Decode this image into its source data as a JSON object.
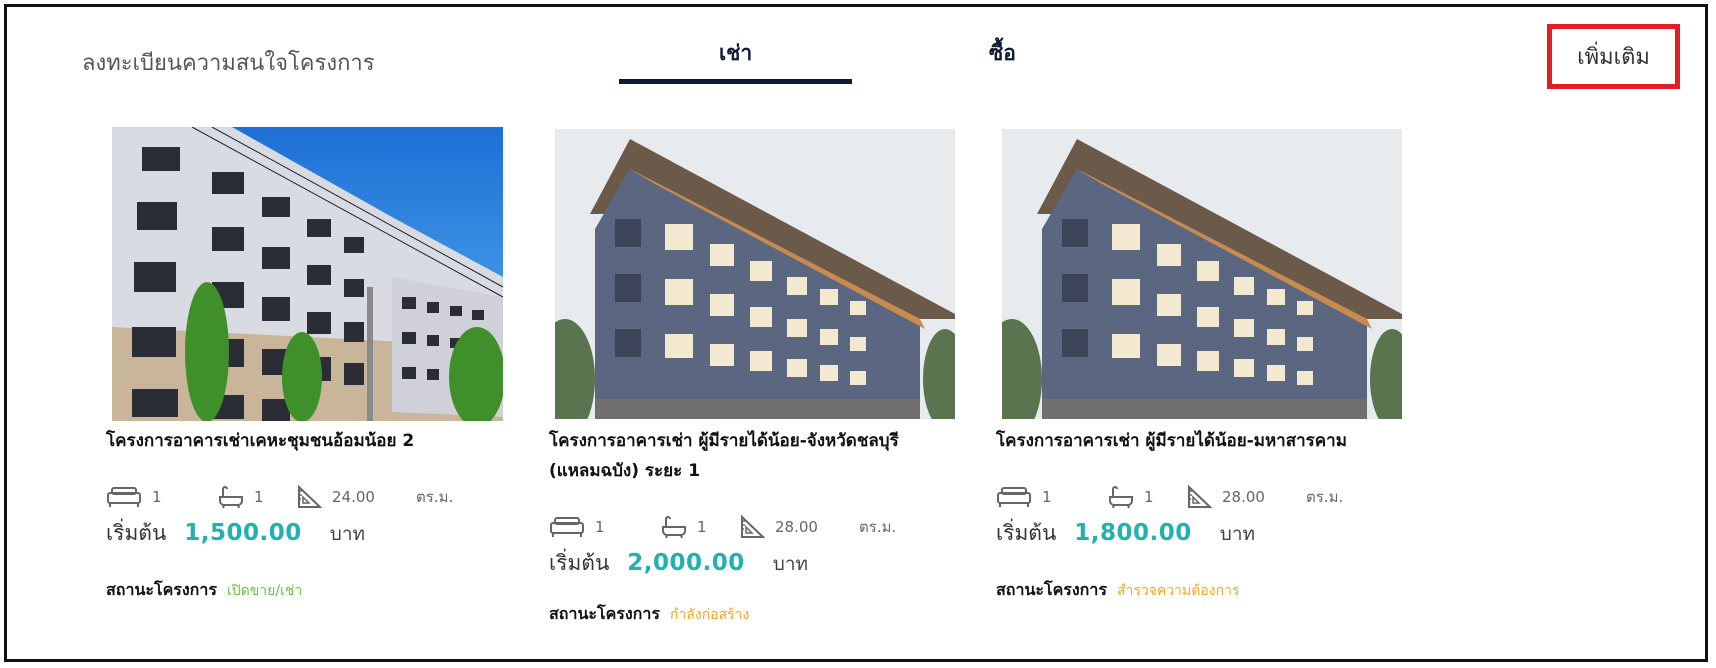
{
  "header": {
    "title": "ลงทะเบียนความสนใจโครงการ",
    "more_label": "เพิ่มเติม"
  },
  "tabs": [
    {
      "label": "เช่า",
      "active": true
    },
    {
      "label": "ซื้อ",
      "active": false
    }
  ],
  "colors": {
    "accent_teal": "#1fb2b0",
    "tab_active": "#0f1b34",
    "highlight_red": "#e21f26",
    "status_green": "#6cc04a",
    "status_orange": "#f5a623"
  },
  "projects": [
    {
      "title_line1": "โครงการอาคารเช่าเคหะชุมชนอ้อมน้อย 2",
      "title_line2": "",
      "beds": "1",
      "baths": "1",
      "area": "24.00",
      "area_unit": "ตร.ม.",
      "price_prefix": "เริ่มต้น",
      "price": "1,500.00",
      "price_unit": "บาท",
      "status_label": "สถานะโครงการ",
      "status": "เปิดขาย/เช่า",
      "status_color": "#6cc04a"
    },
    {
      "title_line1": "โครงการอาคารเช่า ผู้มีรายได้น้อย-จังหวัดชลบุรี",
      "title_line2": "(แหลมฉบัง) ระยะ 1",
      "beds": "1",
      "baths": "1",
      "area": "28.00",
      "area_unit": "ตร.ม.",
      "price_prefix": "เริ่มต้น",
      "price": "2,000.00",
      "price_unit": "บาท",
      "status_label": "สถานะโครงการ",
      "status": "กำลังก่อสร้าง",
      "status_color": "#f5a623"
    },
    {
      "title_line1": "โครงการอาคารเช่า ผู้มีรายได้น้อย-มหาสารคาม",
      "title_line2": "",
      "beds": "1",
      "baths": "1",
      "area": "28.00",
      "area_unit": "ตร.ม.",
      "price_prefix": "เริ่มต้น",
      "price": "1,800.00",
      "price_unit": "บาท",
      "status_label": "สถานะโครงการ",
      "status": "สำรวจความต้องการ",
      "status_color": "#f5a623"
    }
  ]
}
